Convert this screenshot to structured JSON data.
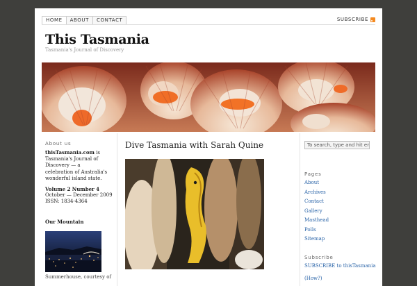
{
  "nav": {
    "tabs": [
      {
        "label": "HOME"
      },
      {
        "label": "ABOUT"
      },
      {
        "label": "CONTACT"
      }
    ],
    "subscribe_label": "SUBSCRIBE"
  },
  "site": {
    "title": "This Tasmania",
    "description": "Tasmania's Journal of Discovery"
  },
  "banner": {
    "icon": "scallop-shells-photo"
  },
  "sidebar_left": {
    "about_title": "About us",
    "about_site": "thisTasmania.com",
    "about_body": " is Tasmania's Journal of Discovery — a celebration of Australia's wonderful island state.",
    "volume": "Volume 2 Number 4",
    "dates": "October — December 2009",
    "issn": "ISSN: 1834-4364",
    "mountain_title": "Our Mountain",
    "mountain_caption": "Summerhouse, courtesy of"
  },
  "post": {
    "title": "Dive Tasmania with Sarah Quine",
    "image_icon": "seahorse-photo"
  },
  "sidebar_right": {
    "search_placeholder": "To search, type and hit enter",
    "pages_title": "Pages",
    "pages": [
      "About",
      "Archives",
      "Contact",
      "Gallery",
      "Masthead",
      "Polls",
      "Sitemap"
    ],
    "subscribe_title": "Subscribe",
    "subscribe_link": "SUBSCRIBE to thisTasmania",
    "how_link": "(How?)"
  },
  "colors": {
    "link": "#2a64a8",
    "background": "#3f3f3c",
    "rss": "#f48a20"
  }
}
